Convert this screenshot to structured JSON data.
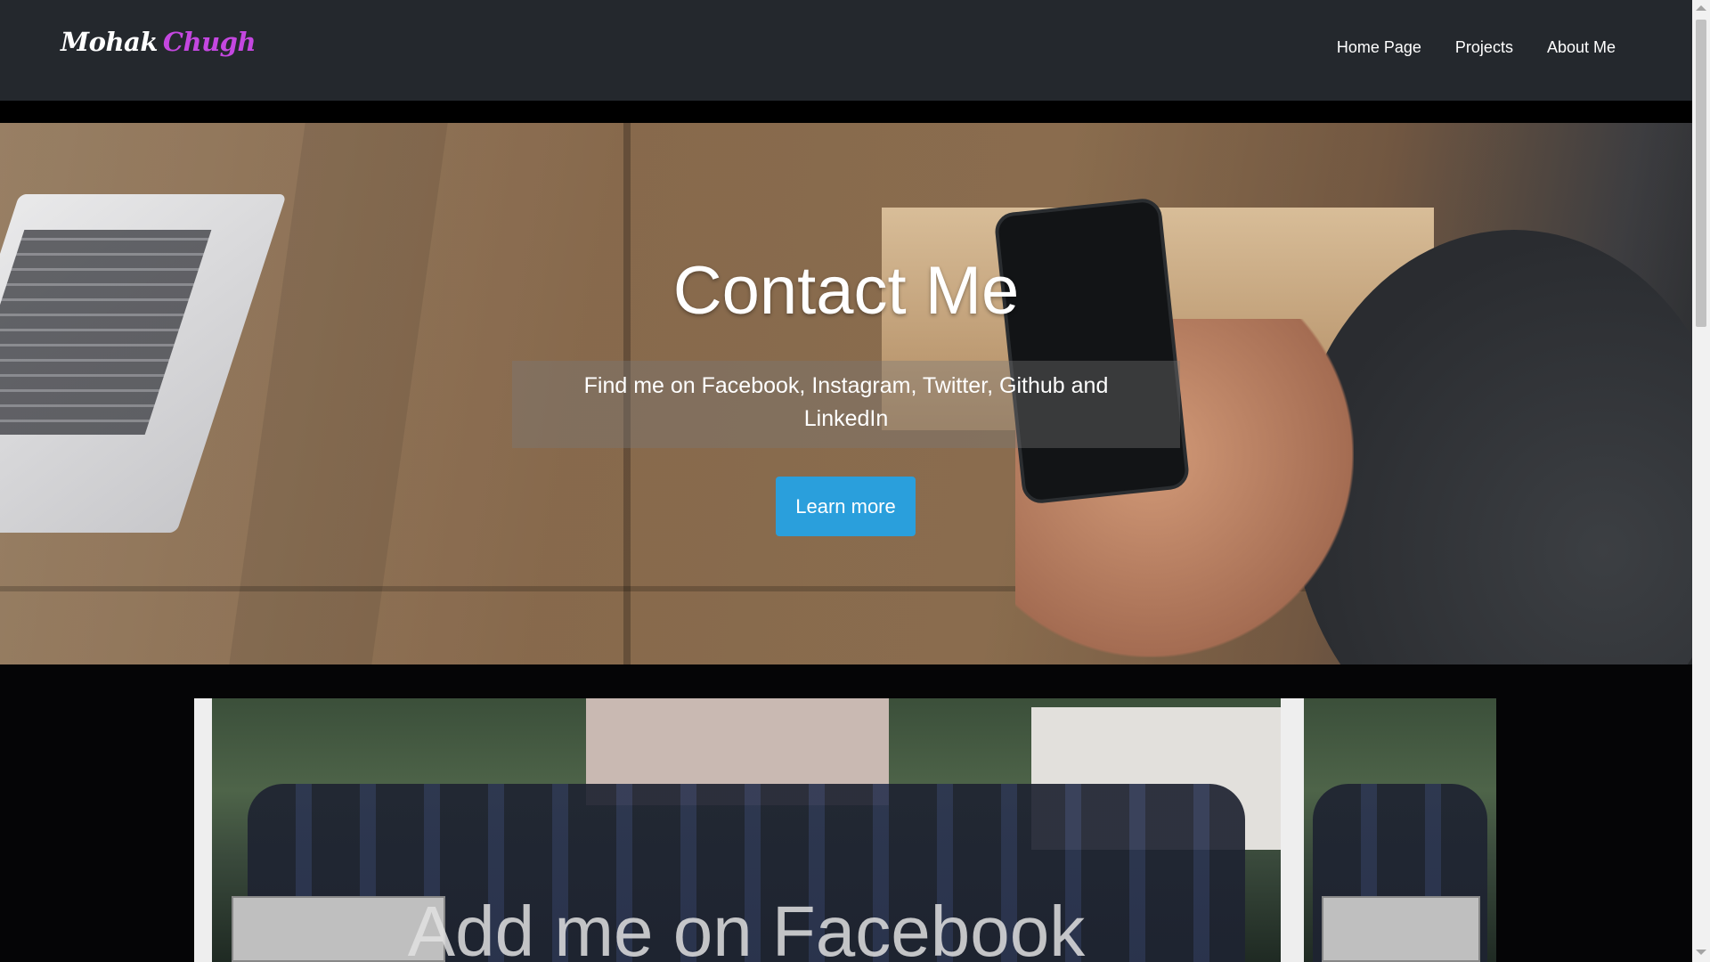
{
  "navbar": {
    "brand_first": "Mohak",
    "brand_last": "Chugh",
    "links": [
      "Home Page",
      "Projects",
      "About Me"
    ]
  },
  "hero": {
    "title": "Contact Me",
    "subtitle": "Find me on Facebook, Instagram, Twitter, Github and LinkedIn",
    "button": "Learn more"
  },
  "carousel": {
    "caption": "Add me on Facebook"
  },
  "colors": {
    "navbar_bg": "#24282d",
    "brand_accent": "#c447e0",
    "button_bg": "#2a9fdc",
    "page_bg": "#050506"
  }
}
